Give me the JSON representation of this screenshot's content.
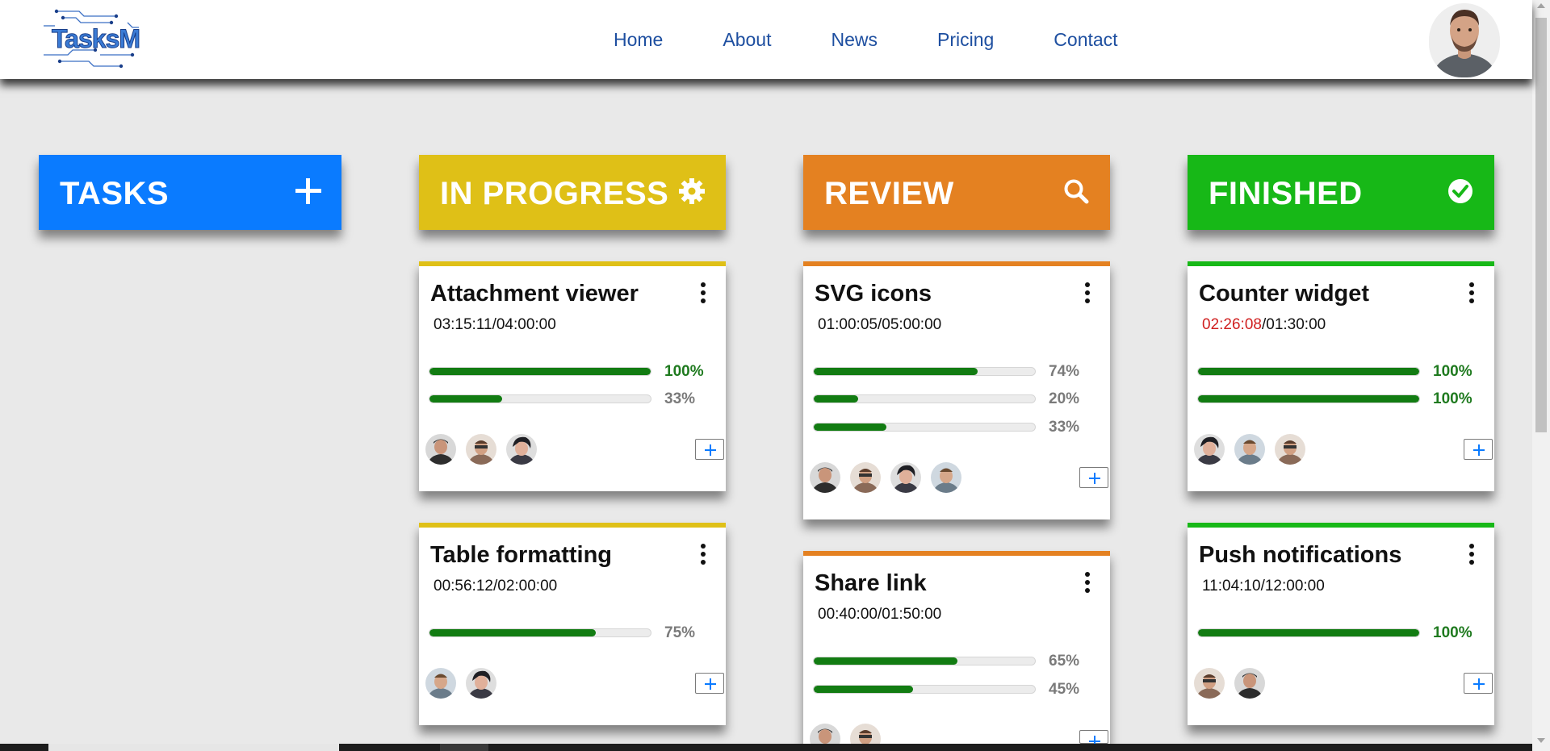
{
  "header": {
    "logo_text": "TasksM",
    "nav": [
      "Home",
      "About",
      "News",
      "Pricing",
      "Contact"
    ]
  },
  "colors": {
    "tasks": "#0a7bff",
    "in_progress": "#dfc017",
    "review": "#e48121",
    "finished": "#17b817",
    "progress_fill": "#127c12",
    "overtime": "#d01f1f"
  },
  "columns": [
    {
      "label": "TASKS",
      "icon": "plus-icon"
    },
    {
      "label": "IN PROGRESS",
      "icon": "gear-icon"
    },
    {
      "label": "REVIEW",
      "icon": "search-icon"
    },
    {
      "label": "FINISHED",
      "icon": "check-circle-icon"
    }
  ],
  "cards": {
    "in_progress": [
      {
        "title": "Attachment viewer",
        "elapsed": "03:15:11",
        "estimate": "/04:00:00",
        "progress": [
          "100%",
          "33%"
        ],
        "avatars": 3
      },
      {
        "title": "Table formatting",
        "elapsed": "00:56:12",
        "estimate": "/02:00:00",
        "progress": [
          "75%"
        ],
        "avatars": 2
      }
    ],
    "review": [
      {
        "title": "SVG icons",
        "elapsed": "01:00:05",
        "estimate": "/05:00:00",
        "progress": [
          "74%",
          "20%",
          "33%"
        ],
        "avatars": 4
      },
      {
        "title": "Share link",
        "elapsed": "00:40:00",
        "estimate": "/01:50:00",
        "progress": [
          "65%",
          "45%"
        ],
        "avatars": 2
      }
    ],
    "finished": [
      {
        "title": "Counter widget",
        "elapsed": "02:26:08",
        "estimate": "/01:30:00",
        "overtime": true,
        "progress": [
          "100%",
          "100%"
        ],
        "avatars": 3
      },
      {
        "title": "Push notifications",
        "elapsed": "11:04:10",
        "estimate": "/12:00:00",
        "progress": [
          "100%"
        ],
        "avatars": 2
      }
    ]
  }
}
